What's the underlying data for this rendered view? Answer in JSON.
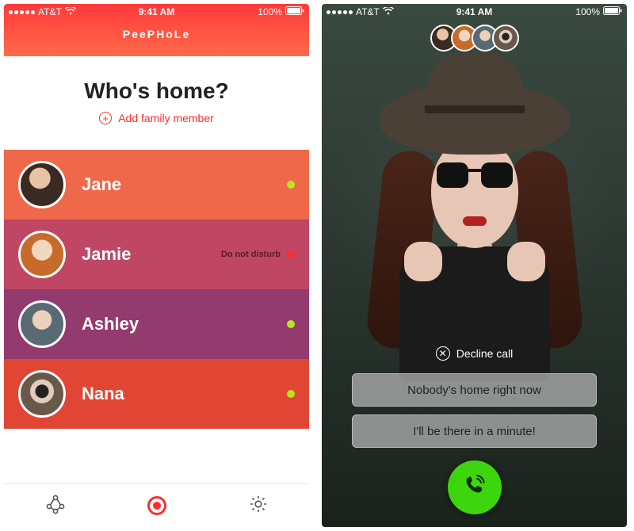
{
  "status": {
    "carrier": "AT&T",
    "time": "9:41 AM",
    "battery": "100%"
  },
  "left": {
    "app_title": "PeePHoLe",
    "heading": "Who's home?",
    "add_label": "Add family member",
    "members": [
      {
        "name": "Jane",
        "status_label": "",
        "presence": "green"
      },
      {
        "name": "Jamie",
        "status_label": "Do not disturb",
        "presence": "red"
      },
      {
        "name": "Ashley",
        "status_label": "",
        "presence": "green"
      },
      {
        "name": "Nana",
        "status_label": "",
        "presence": "green"
      }
    ],
    "tabs": {
      "left_icon": "people-network-icon",
      "center_icon": "record-icon",
      "right_icon": "gear-icon"
    }
  },
  "right": {
    "decline_label": "Decline call",
    "quick_replies": [
      "Nobody's home right now",
      "I'll be there in a minute!"
    ]
  }
}
